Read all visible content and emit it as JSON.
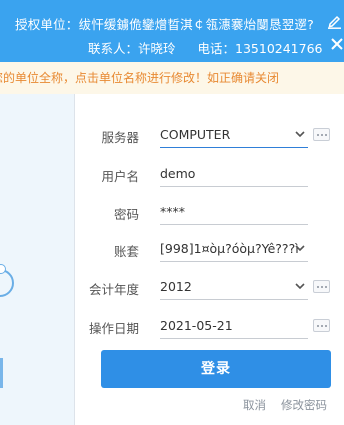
{
  "header": {
    "auth_unit": "授权单位：绂忓缓鐪佹鑾熷晢淇￠瓴潓褰炲闅恳翌遻?",
    "contact_label": "联系人：许晓玲",
    "phone_label": "电话：13510241766"
  },
  "notice": {
    "text": "您的单位全称，点击单位名称进行修改！如正确请关闭"
  },
  "form": {
    "server": {
      "label": "服务器",
      "value": "COMPUTER"
    },
    "username": {
      "label": "用户名",
      "value": "demo"
    },
    "password": {
      "label": "密码",
      "value": "****"
    },
    "account_set": {
      "label": "账套",
      "value": "[998]1¤òµ?óòµ?Yê???ì"
    },
    "fiscal_year": {
      "label": "会计年度",
      "value": "2012"
    },
    "operation_date": {
      "label": "操作日期",
      "value": "2021-05-21"
    }
  },
  "actions": {
    "login": "登录",
    "cancel": "取消",
    "change_password": "修改密码"
  },
  "colors": {
    "header_bg": "#3aa3ef",
    "notice_bg": "#fdf7e8",
    "notice_text": "#e88a33",
    "primary": "#2f8fe6"
  },
  "icons": [
    "edit-icon",
    "close-icon",
    "chevron-down-icon",
    "more-options-icon"
  ]
}
